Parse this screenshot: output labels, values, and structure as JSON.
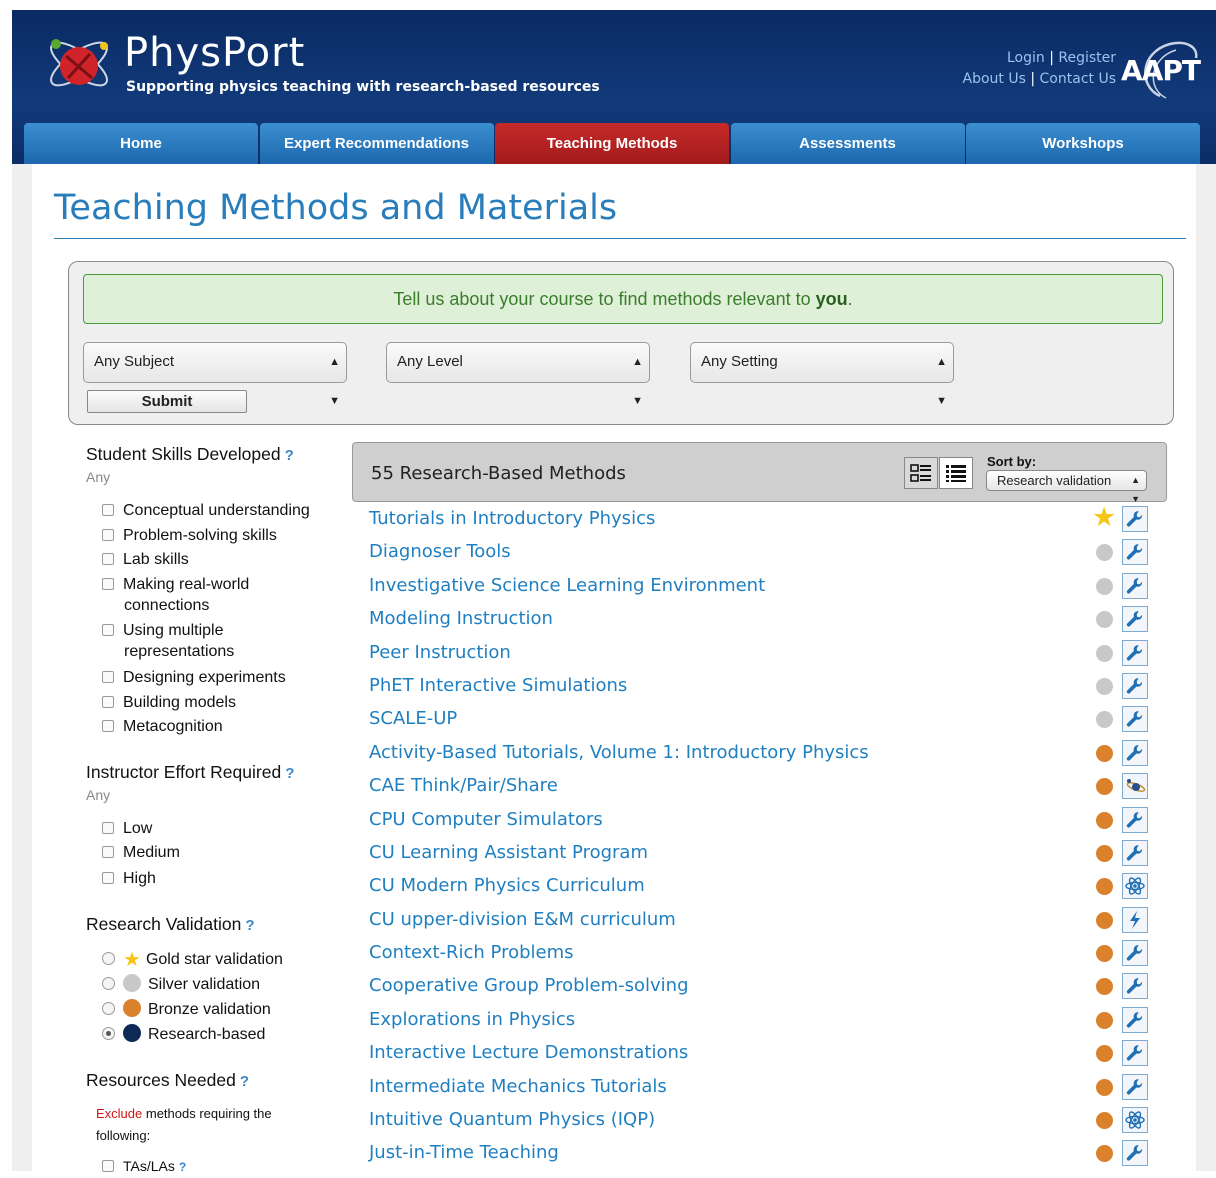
{
  "header": {
    "site_title": "PhysPort",
    "tagline": "Supporting physics teaching with research-based resources",
    "login": "Login",
    "register": "Register",
    "about": "About Us",
    "contact": "Contact Us",
    "aapt": "AAPT"
  },
  "nav": {
    "tabs": [
      {
        "label": "Home"
      },
      {
        "label": "Expert Recommendations"
      },
      {
        "label": "Teaching Methods"
      },
      {
        "label": "Assessments"
      },
      {
        "label": "Workshops"
      }
    ]
  },
  "page": {
    "title": "Teaching Methods and Materials"
  },
  "filters": {
    "banner_prefix": "Tell us about your course to find methods relevant to ",
    "banner_bold": "you",
    "banner_suffix": ".",
    "subject": "Any Subject",
    "level": "Any Level",
    "setting": "Any Setting",
    "submit": "Submit"
  },
  "sidebar": {
    "skills_heading": "Student Skills Developed",
    "skills_any": "Any",
    "skills": [
      {
        "label": "Conceptual understanding"
      },
      {
        "label": "Problem-solving skills"
      },
      {
        "label": "Lab skills"
      },
      {
        "label": "Making real-world",
        "label2": "connections"
      },
      {
        "label": "Using multiple",
        "label2": "representations"
      },
      {
        "label": "Designing experiments"
      },
      {
        "label": "Building models"
      },
      {
        "label": "Metacognition"
      }
    ],
    "effort_heading": "Instructor Effort Required",
    "effort_any": "Any",
    "effort": [
      {
        "label": "Low"
      },
      {
        "label": "Medium"
      },
      {
        "label": "High"
      }
    ],
    "validation_heading": "Research Validation",
    "validation": [
      {
        "label": "Gold star validation"
      },
      {
        "label": "Silver validation"
      },
      {
        "label": "Bronze validation"
      },
      {
        "label": "Research-based"
      }
    ],
    "resources_heading": "Resources Needed",
    "exclude_word": "Exclude",
    "exclude_rest": " methods requiring the following:",
    "resources": [
      {
        "label": "TAs/LAs"
      }
    ],
    "help_mark": "?"
  },
  "results": {
    "count_label": "55 Research-Based Methods",
    "sort_label": "Sort by:",
    "sort_value": "Research validation",
    "methods": [
      {
        "title": "Tutorials in Introductory Physics",
        "validation": "gold",
        "type": "wrench-icon"
      },
      {
        "title": "Diagnoser Tools",
        "validation": "silver",
        "type": "wrench-icon"
      },
      {
        "title": "Investigative Science Learning Environment",
        "validation": "silver",
        "type": "wrench-icon"
      },
      {
        "title": "Modeling Instruction",
        "validation": "silver",
        "type": "wrench-icon"
      },
      {
        "title": "Peer Instruction",
        "validation": "silver",
        "type": "wrench-icon"
      },
      {
        "title": "PhET Interactive Simulations",
        "validation": "silver",
        "type": "wrench-icon"
      },
      {
        "title": "SCALE-UP",
        "validation": "silver",
        "type": "wrench-icon"
      },
      {
        "title": "Activity-Based Tutorials, Volume 1: Introductory Physics",
        "validation": "bronze",
        "type": "wrench-icon"
      },
      {
        "title": "CAE Think/Pair/Share",
        "validation": "bronze",
        "type": "planet-icon"
      },
      {
        "title": "CPU Computer Simulators",
        "validation": "bronze",
        "type": "wrench-icon"
      },
      {
        "title": "CU Learning Assistant Program",
        "validation": "bronze",
        "type": "wrench-icon"
      },
      {
        "title": "CU Modern Physics Curriculum",
        "validation": "bronze",
        "type": "atom-icon"
      },
      {
        "title": "CU upper-division E&M curriculum",
        "validation": "bronze",
        "type": "lightning-icon"
      },
      {
        "title": "Context-Rich Problems",
        "validation": "bronze",
        "type": "wrench-icon"
      },
      {
        "title": "Cooperative Group Problem-solving",
        "validation": "bronze",
        "type": "wrench-icon"
      },
      {
        "title": "Explorations in Physics",
        "validation": "bronze",
        "type": "wrench-icon"
      },
      {
        "title": "Interactive Lecture Demonstrations",
        "validation": "bronze",
        "type": "wrench-icon"
      },
      {
        "title": "Intermediate Mechanics Tutorials",
        "validation": "bronze",
        "type": "wrench-icon"
      },
      {
        "title": "Intuitive Quantum Physics (IQP)",
        "validation": "bronze",
        "type": "atom-icon"
      },
      {
        "title": "Just-in-Time Teaching",
        "validation": "bronze",
        "type": "wrench-icon"
      }
    ]
  },
  "colors": {
    "gold": "#f5c518",
    "silver": "#c8c8c8",
    "bronze": "#d9822b",
    "research": "#0d2a57",
    "link": "#1f7fc0",
    "nav_active": "#b52222",
    "nav": "#2a78c0"
  }
}
